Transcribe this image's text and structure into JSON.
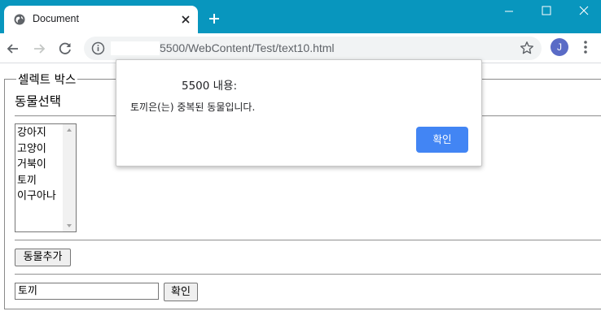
{
  "browser": {
    "tab_title": "Document",
    "url": "5500/WebContent/Test/text10.html",
    "profile_initial": "J"
  },
  "page": {
    "legend": "셀렉트 박스",
    "heading": "동물선택",
    "animals": [
      "강아지",
      "고양이",
      "거북이",
      "토끼",
      "이구아나"
    ],
    "add_button": "동물추가",
    "input_value": "토끼",
    "confirm_button": "확인"
  },
  "dialog": {
    "title": "5500 내용:",
    "message": "토끼은(는) 중복된 동물입니다.",
    "ok_button": "확인"
  },
  "colors": {
    "titlebar": "#0896be",
    "dialog_button": "#4285f4"
  }
}
